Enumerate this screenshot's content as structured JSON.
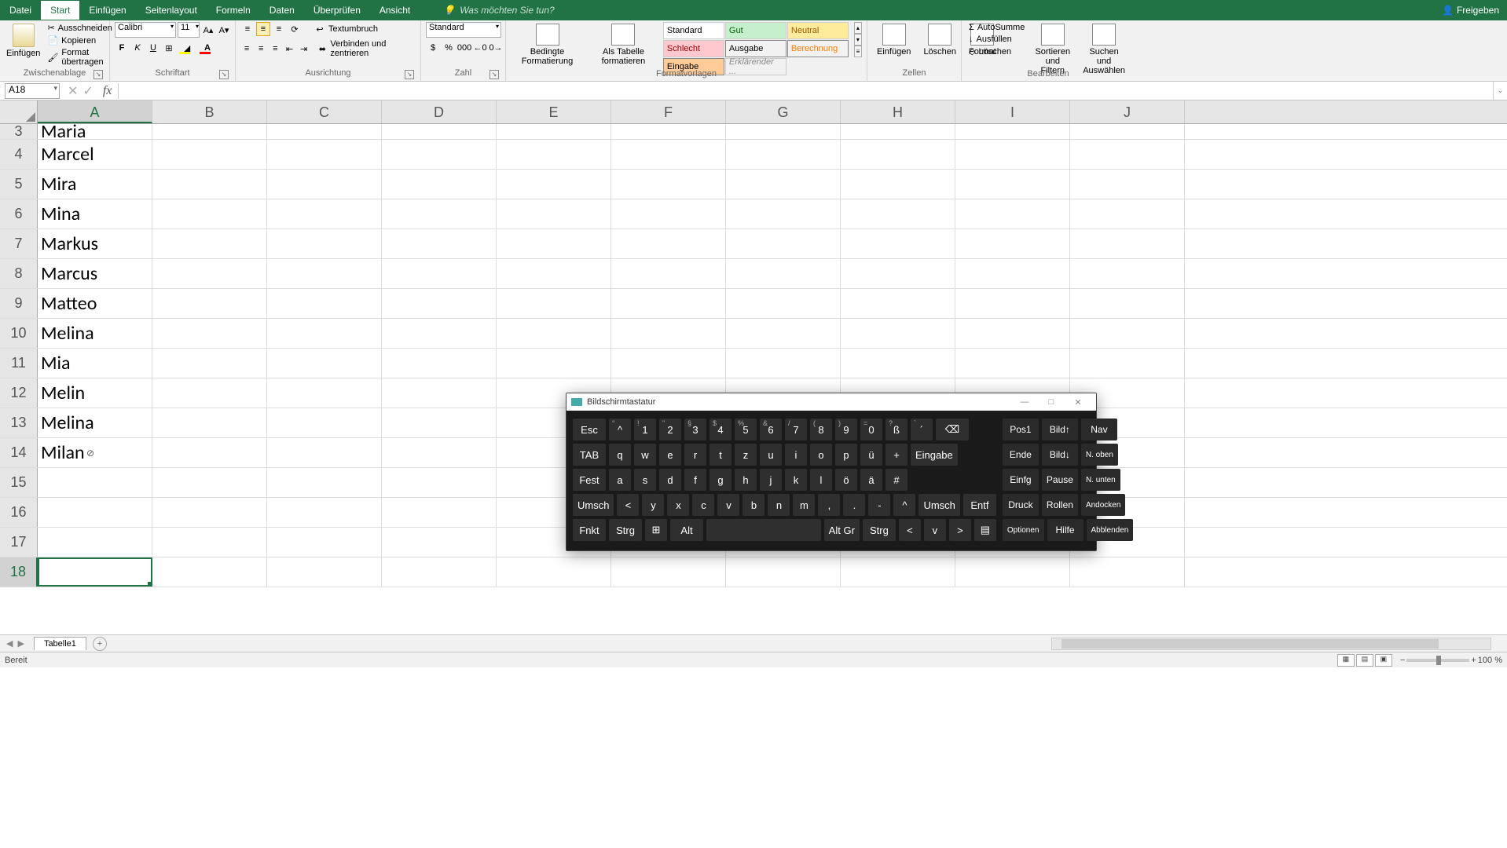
{
  "tabs": {
    "file": "Datei",
    "start": "Start",
    "einfuegen": "Einfügen",
    "seitenlayout": "Seitenlayout",
    "formeln": "Formeln",
    "daten": "Daten",
    "ueberpruefen": "Überprüfen",
    "ansicht": "Ansicht"
  },
  "tellme": "Was möchten Sie tun?",
  "share": "Freigeben",
  "clipboard": {
    "paste": "Einfügen",
    "cut": "Ausschneiden",
    "copy": "Kopieren",
    "painter": "Format übertragen",
    "group": "Zwischenablage"
  },
  "font": {
    "name": "Calibri",
    "size": "11",
    "group": "Schriftart"
  },
  "align": {
    "wrap": "Textumbruch",
    "merge": "Verbinden und zentrieren",
    "group": "Ausrichtung"
  },
  "number": {
    "format": "Standard",
    "group": "Zahl"
  },
  "styles": {
    "cond": "Bedingte Formatierung",
    "table": "Als Tabelle formatieren",
    "s1": "Standard",
    "s2": "Gut",
    "s3": "Neutral",
    "s4": "Schlecht",
    "s5": "Ausgabe",
    "s6": "Berechnung",
    "s7": "Eingabe",
    "s8": "Erklärender ...",
    "group": "Formatvorlagen"
  },
  "cells": {
    "insert": "Einfügen",
    "delete": "Löschen",
    "format": "Format",
    "group": "Zellen"
  },
  "editing": {
    "sum": "AutoSumme",
    "fill": "Ausfüllen",
    "clear": "Löschen",
    "sort": "Sortieren und Filtern",
    "find": "Suchen und Auswählen",
    "group": "Bearbeiten"
  },
  "namebox": "A18",
  "columns": [
    "A",
    "B",
    "C",
    "D",
    "E",
    "F",
    "G",
    "H",
    "I",
    "J"
  ],
  "rows": [
    {
      "n": "3",
      "v": "Maria",
      "clip": true
    },
    {
      "n": "4",
      "v": "Marcel"
    },
    {
      "n": "5",
      "v": "Mira"
    },
    {
      "n": "6",
      "v": "Mina"
    },
    {
      "n": "7",
      "v": "Markus"
    },
    {
      "n": "8",
      "v": "Marcus"
    },
    {
      "n": "9",
      "v": "Matteo"
    },
    {
      "n": "10",
      "v": "Melina"
    },
    {
      "n": "11",
      "v": "Mia"
    },
    {
      "n": "12",
      "v": "Melin"
    },
    {
      "n": "13",
      "v": "Melina"
    },
    {
      "n": "14",
      "v": "Milan"
    },
    {
      "n": "15",
      "v": ""
    },
    {
      "n": "16",
      "v": ""
    },
    {
      "n": "17",
      "v": ""
    },
    {
      "n": "18",
      "v": "",
      "active": true
    }
  ],
  "sheet": "Tabelle1",
  "status": "Bereit",
  "zoom": "100 %",
  "osk": {
    "title": "Bildschirmtastatur",
    "r1": [
      "Esc",
      "^",
      "1",
      "2",
      "3",
      "4",
      "5",
      "6",
      "7",
      "8",
      "9",
      "0",
      "ß",
      "´",
      "⌫"
    ],
    "r1sup": [
      "",
      "°",
      "!",
      "\"",
      "§",
      "$",
      "%",
      "&",
      "/",
      "(",
      ")",
      "=",
      "?",
      "`",
      ""
    ],
    "r2": [
      "TAB",
      "q",
      "w",
      "e",
      "r",
      "t",
      "z",
      "u",
      "i",
      "o",
      "p",
      "ü",
      "+",
      "Eingabe"
    ],
    "r3": [
      "Fest",
      "a",
      "s",
      "d",
      "f",
      "g",
      "h",
      "j",
      "k",
      "l",
      "ö",
      "ä",
      "#"
    ],
    "r4": [
      "Umsch",
      "<",
      "y",
      "x",
      "c",
      "v",
      "b",
      "n",
      "m",
      ",",
      ".",
      "-",
      "^",
      "Umsch",
      "Entf"
    ],
    "r5": [
      "Fnkt",
      "Strg",
      "⊞",
      "Alt",
      "",
      "Alt Gr",
      "Strg",
      "<",
      "v",
      ">",
      "▤"
    ],
    "nav": [
      [
        "Pos1",
        "Bild↑",
        "Nav"
      ],
      [
        "Ende",
        "Bild↓",
        "N. oben"
      ],
      [
        "Einfg",
        "Pause",
        "N. unten"
      ],
      [
        "Druck",
        "Rollen",
        "Andocken"
      ],
      [
        "Optionen",
        "Hilfe",
        "Abblenden"
      ]
    ]
  }
}
